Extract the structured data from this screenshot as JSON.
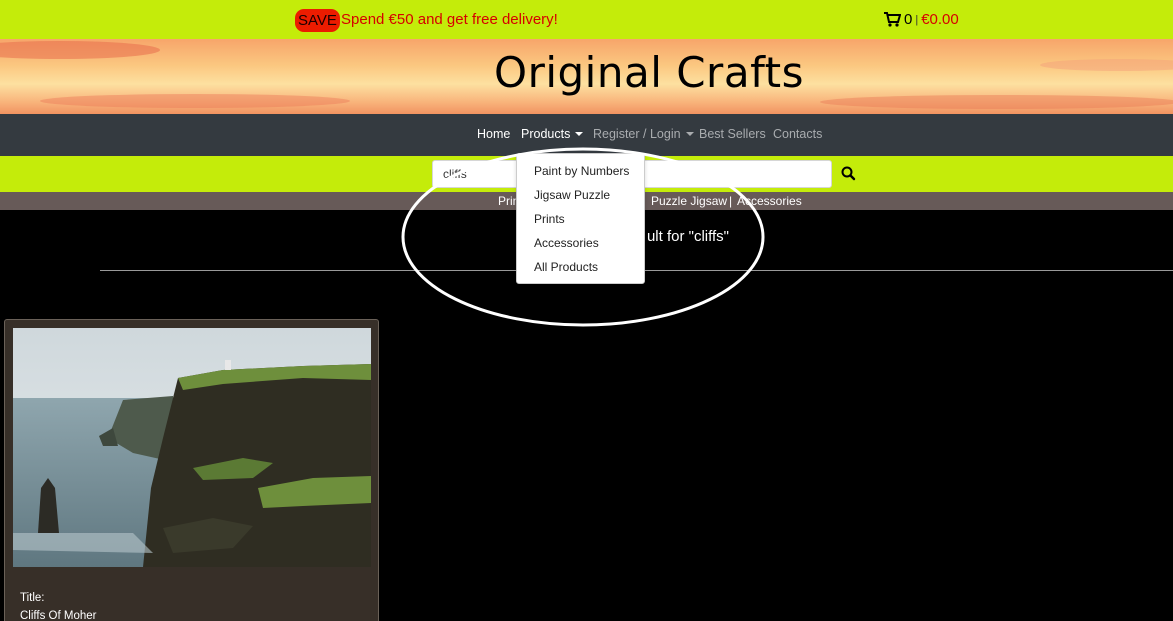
{
  "promo": {
    "badge": "SAVE",
    "text": "Spend €50 and get free delivery!",
    "cart_count": "0",
    "cart_sep": "|",
    "cart_total": "€0.00"
  },
  "header": {
    "title": "Original Crafts"
  },
  "nav": {
    "home": "Home",
    "products": "Products",
    "register": "Register / Login",
    "best_sellers": "Best Sellers",
    "contacts": "Contacts"
  },
  "search": {
    "value": "cliffs"
  },
  "categories": {
    "prints": "Prin",
    "puzzle_jigsaw": "Puzzle Jigsaw",
    "sep": "|",
    "accessories": "Accessories"
  },
  "results": {
    "text": "ult for \"cliffs\""
  },
  "card": {
    "title_label": "Title:",
    "title_value": "Cliffs Of Moher"
  },
  "dropdown": {
    "items": [
      "Paint by Numbers",
      "Jigsaw Puzzle",
      "Prints",
      "Accessories",
      "All Products"
    ]
  },
  "colors": {
    "lime": "#c4ec0a",
    "navbar": "#343a40",
    "catbar": "#675a58",
    "accent_red": "#d60000"
  }
}
